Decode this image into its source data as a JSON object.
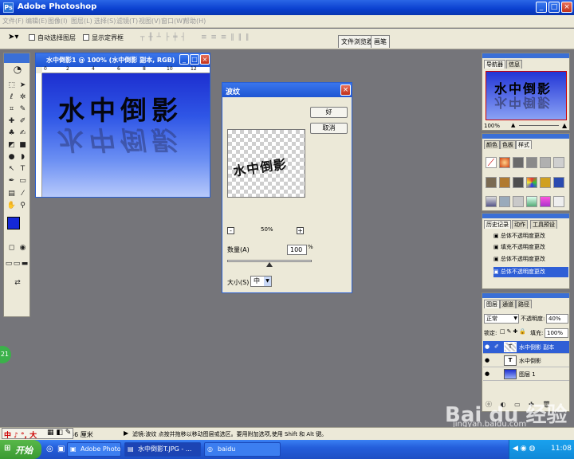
{
  "app": {
    "title": "Adobe Photoshop"
  },
  "menu": [
    "文件(F)",
    "编辑(E)",
    "图像(I)",
    "图层(L)",
    "选择(S)",
    "滤镜(T)",
    "视图(V)",
    "窗口(W)",
    "帮助(H)"
  ],
  "options": {
    "auto_select": "自动选择图层",
    "show_bounds": "显示定界框",
    "tab_browser": "文件浏览器",
    "tab_brushes": "画笔"
  },
  "document": {
    "title": "水中倒影1 @ 100% (水中倒影 副本, RGB)",
    "ruler_marks": [
      "0",
      "2",
      "4",
      "6",
      "8",
      "10",
      "12"
    ],
    "text": "水中倒影"
  },
  "dialog": {
    "title": "波纹",
    "ok": "好",
    "cancel": "取消",
    "zoom_minus": "-",
    "zoom": "50%",
    "zoom_plus": "+",
    "amount_label": "数量(A)",
    "amount_value": "100",
    "amount_unit": "%",
    "amount_level": 0.5,
    "size_label": "大小(S)",
    "size_value": "中"
  },
  "navigator": {
    "tabs": [
      "导航器",
      "信息"
    ],
    "zoom": "100%"
  },
  "swatches": {
    "tabs": [
      "颜色",
      "色板",
      "样式"
    ]
  },
  "history": {
    "tabs": [
      "历史记录",
      "动作",
      "工具预设"
    ],
    "items": [
      "总体不透明度更改",
      "填充不透明度更改",
      "总体不透明度更改",
      "总体不透明度更改"
    ]
  },
  "layers": {
    "tabs": [
      "图层",
      "通道",
      "路径"
    ],
    "blend_mode": "正常",
    "opacity_label": "不透明度:",
    "opacity_value": "40%",
    "lock_label": "锁定:",
    "fill_label": "填充:",
    "fill_value": "100%",
    "rows": [
      {
        "name": "水中倒影 副本",
        "thumb": "T"
      },
      {
        "name": "水中倒影",
        "thumb": "T"
      },
      {
        "name": "图层 1",
        "thumb": ""
      }
    ]
  },
  "status": {
    "zoom": "36 厘米",
    "hint": "滤镜:波纹  点按并拖移以移动图层或选区。要用附加选项,使用 Shift 和 Alt 键。"
  },
  "ime": {
    "label": "中 ♪ °, 大"
  },
  "taskbar": {
    "start": "开始",
    "items": [
      "Adobe Photoshop",
      "水中倒影T.JPG - ...",
      "baidu"
    ],
    "clock": "11:08"
  },
  "watermark": {
    "logo": "Bai du 经验",
    "url": "jingyan.baidu.com"
  },
  "bubble": {
    "text": "21"
  }
}
